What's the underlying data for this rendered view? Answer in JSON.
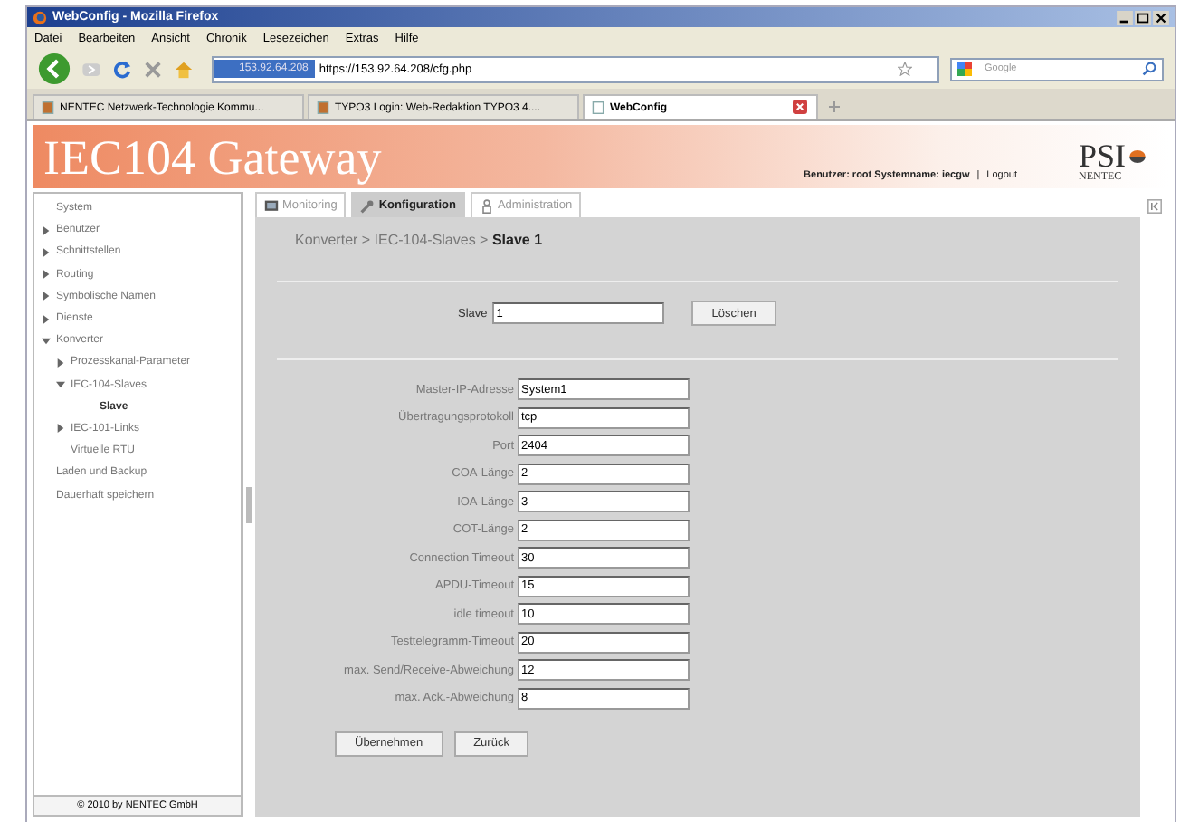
{
  "window": {
    "title": "WebConfig - Mozilla Firefox"
  },
  "menu": [
    "Datei",
    "Bearbeiten",
    "Ansicht",
    "Chronik",
    "Lesezeichen",
    "Extras",
    "Hilfe"
  ],
  "nav": {
    "url_host": "153.92.64.208",
    "url": "https://153.92.64.208/cfg.php",
    "search_placeholder": "Google"
  },
  "browser_tabs": [
    {
      "label": "NENTEC Netzwerk-Technologie Kommu...",
      "selected": false
    },
    {
      "label": "TYPO3 Login: Web-Redaktion TYPO3 4....",
      "selected": false
    },
    {
      "label": "WebConfig",
      "selected": true
    }
  ],
  "header": {
    "title": "IEC104 Gateway",
    "user": "Benutzer: root  Systemname: iecgw",
    "separator": "|",
    "logout": "Logout",
    "logo": "PSI",
    "logo_sub": "NENTEC"
  },
  "sidebar": {
    "items": [
      {
        "label": "System",
        "kind": "leaf",
        "expanded": false,
        "selected": false
      },
      {
        "label": "Benutzer",
        "kind": "folder",
        "expanded": false,
        "selected": false
      },
      {
        "label": "Schnittstellen",
        "kind": "folder",
        "expanded": false,
        "selected": false
      },
      {
        "label": "Routing",
        "kind": "folder",
        "expanded": false,
        "selected": false
      },
      {
        "label": "Symbolische Namen",
        "kind": "folder",
        "expanded": false,
        "selected": false
      },
      {
        "label": "Dienste",
        "kind": "folder",
        "expanded": false,
        "selected": false
      },
      {
        "label": "Konverter",
        "kind": "folder",
        "expanded": true,
        "selected": false,
        "children": [
          {
            "label": "Prozesskanal-Parameter",
            "kind": "folder",
            "expanded": false,
            "selected": false
          },
          {
            "label": "IEC-104-Slaves",
            "kind": "folder",
            "expanded": true,
            "selected": false,
            "children": [
              {
                "label": "Slave",
                "kind": "leaf",
                "expanded": false,
                "selected": true
              }
            ]
          },
          {
            "label": "IEC-101-Links",
            "kind": "folder",
            "expanded": false,
            "selected": false
          },
          {
            "label": "Virtuelle RTU",
            "kind": "leaf",
            "expanded": false,
            "selected": false
          }
        ]
      },
      {
        "label": "Laden und Backup",
        "kind": "leaf",
        "expanded": false,
        "selected": false
      },
      {
        "label": "Dauerhaft speichern",
        "kind": "leaf",
        "expanded": false,
        "selected": false
      }
    ],
    "footer": "© 2010 by NENTEC GmbH"
  },
  "tabs": [
    {
      "label": "Monitoring",
      "selected": false
    },
    {
      "label": "Konfiguration",
      "selected": true
    },
    {
      "label": "Administration",
      "selected": false
    }
  ],
  "breadcrumb": "Konverter > IEC-104-Slaves > **Slave 1**",
  "slave": {
    "label": "Slave",
    "value": "1",
    "button": "Löschen"
  },
  "fields": [
    {
      "label": "Master-IP-Adresse",
      "value": "System1"
    },
    {
      "label": "Übertragungsprotokoll",
      "value": "tcp"
    },
    {
      "label": "Port",
      "value": "2404"
    },
    {
      "label": "COA-Länge",
      "value": "2"
    },
    {
      "label": "IOA-Länge",
      "value": "3"
    },
    {
      "label": "COT-Länge",
      "value": "2"
    },
    {
      "label": "Connection Timeout",
      "value": "30"
    },
    {
      "label": "APDU-Timeout",
      "value": "15"
    },
    {
      "label": "idle timeout",
      "value": "10"
    },
    {
      "label": "Testtelegramm-Timeout",
      "value": "20"
    },
    {
      "label": "max. Send/Receive-Abweichung",
      "value": "12"
    },
    {
      "label": "max. Ack.-Abweichung",
      "value": "8"
    }
  ],
  "buttons": [
    "Übernehmen",
    "Zurück"
  ]
}
